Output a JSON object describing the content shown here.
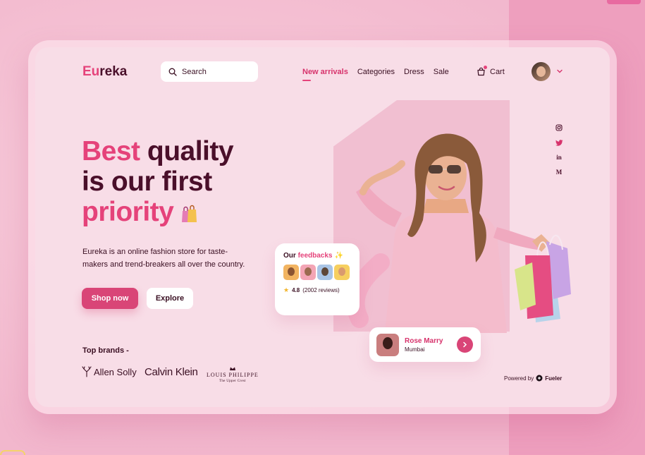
{
  "app": {
    "logo_accent": "Eu",
    "logo_rest": "reka"
  },
  "search": {
    "placeholder": "Search"
  },
  "nav": {
    "items": [
      "New arrivals",
      "Categories",
      "Dress",
      "Sale"
    ],
    "active": "New arrivals"
  },
  "cart": {
    "label": "Cart"
  },
  "hero": {
    "title_line1_pink": "Best",
    "title_line1_rest": " quality",
    "title_line2": "is our first",
    "title_line3": "priority",
    "description": "Eureka is an online fashion store for taste-makers and trend-breakers all over the country."
  },
  "buttons": {
    "shop_now": "Shop now",
    "explore": "Explore"
  },
  "brands": {
    "title": "Top brands -",
    "allen": "Allen Solly",
    "calvin": "Calvin Klein",
    "louis_main": "LOUIS PHILIPPE",
    "louis_sub": "The Upper Crest"
  },
  "feedback": {
    "title_prefix": "Our ",
    "title_accent": "feedbacks",
    "sparkle": "✨",
    "rating": "4.8",
    "reviews": "(2002 reviews)"
  },
  "profile": {
    "name": "Rose Marry",
    "city": "Mumbai"
  },
  "social": {
    "medium": "M",
    "linkedin": "in"
  },
  "powered": {
    "prefix": "Powered by",
    "brand": "Fueler"
  },
  "colors": {
    "accent": "#e5427a",
    "dark": "#4a0f2a",
    "card": "#f8dde7",
    "background": "#f2b7cd"
  },
  "icons": [
    "search-icon",
    "cart-icon",
    "chevron-down-icon",
    "instagram-icon",
    "twitter-icon",
    "linkedin-icon",
    "medium-icon",
    "star-icon",
    "chevron-right-icon",
    "fueler-logo-icon",
    "shopping-bag-icon"
  ]
}
